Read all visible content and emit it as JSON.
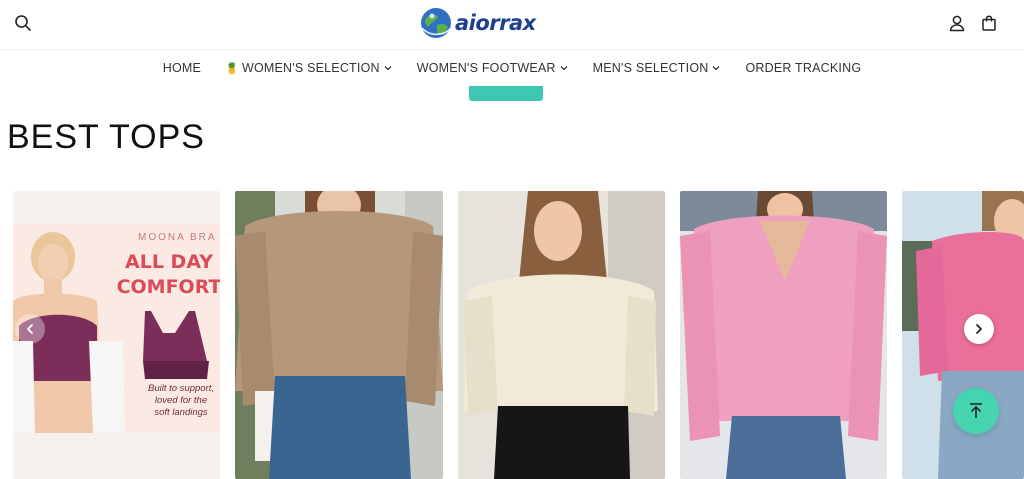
{
  "header": {
    "brand": "aiorrax",
    "icons": {
      "search": "search-icon",
      "account": "user-icon",
      "cart": "bag-icon"
    }
  },
  "nav": {
    "items": [
      {
        "label": "HOME",
        "dropdown": false
      },
      {
        "label": "WOMEN'S SELECTION",
        "dropdown": true,
        "emoji": "🍍"
      },
      {
        "label": "WOMEN'S FOOTWEAR",
        "dropdown": true
      },
      {
        "label": "MEN'S SELECTION",
        "dropdown": true
      },
      {
        "label": "ORDER TRACKING",
        "dropdown": false
      }
    ]
  },
  "section": {
    "title": "BEST TOPS"
  },
  "promo": {
    "brand": "MOONA BRA",
    "headline_1": "ALL DAY",
    "headline_2": "COMFORT",
    "sub_1": "Built to support,",
    "sub_2": "loved for the",
    "sub_3": "soft landings"
  },
  "colors": {
    "accent": "#3ec8b4",
    "scroll_top": "#46d3b0",
    "promo_red": "#d94b57"
  },
  "carousel": {
    "prev_icon": "chevron-left-icon",
    "next_icon": "chevron-right-icon",
    "scroll_top_icon": "arrow-up-icon"
  }
}
